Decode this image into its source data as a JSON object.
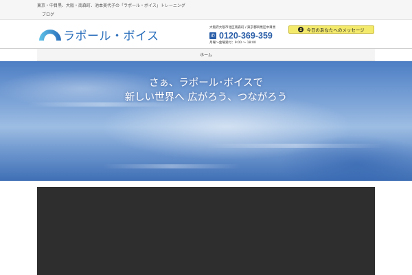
{
  "topbar": {
    "tagline": "東京・中目黒、大阪・南森町、池本美代子の「ラポール・ボイス」トレーニング",
    "blog_label": "ブログ"
  },
  "header": {
    "logo_text": "ラポール・ボイス",
    "address": "大阪府大阪市北区南森町 / 東京都目黒区中目黒",
    "phone": "0120-369-359",
    "hours": "月曜〜金曜受付：9:00 〜 18:00",
    "message_button": "今日のあなたへのメッセージ"
  },
  "nav": {
    "items": [
      {
        "label": "ホーム"
      }
    ]
  },
  "hero": {
    "line1": "さぁ、ラポール･ボイスで",
    "line2": "新しい世界へ 広がろう、つながろう"
  },
  "colors": {
    "brand_blue": "#2a6ebb",
    "phone_blue": "#2a5ea8",
    "message_yellow": "#f3e96a",
    "video_bg": "#2e2e2e"
  },
  "icons": {
    "logo": "arc-logo-icon",
    "phone": "phone-icon",
    "message": "smile-icon"
  }
}
